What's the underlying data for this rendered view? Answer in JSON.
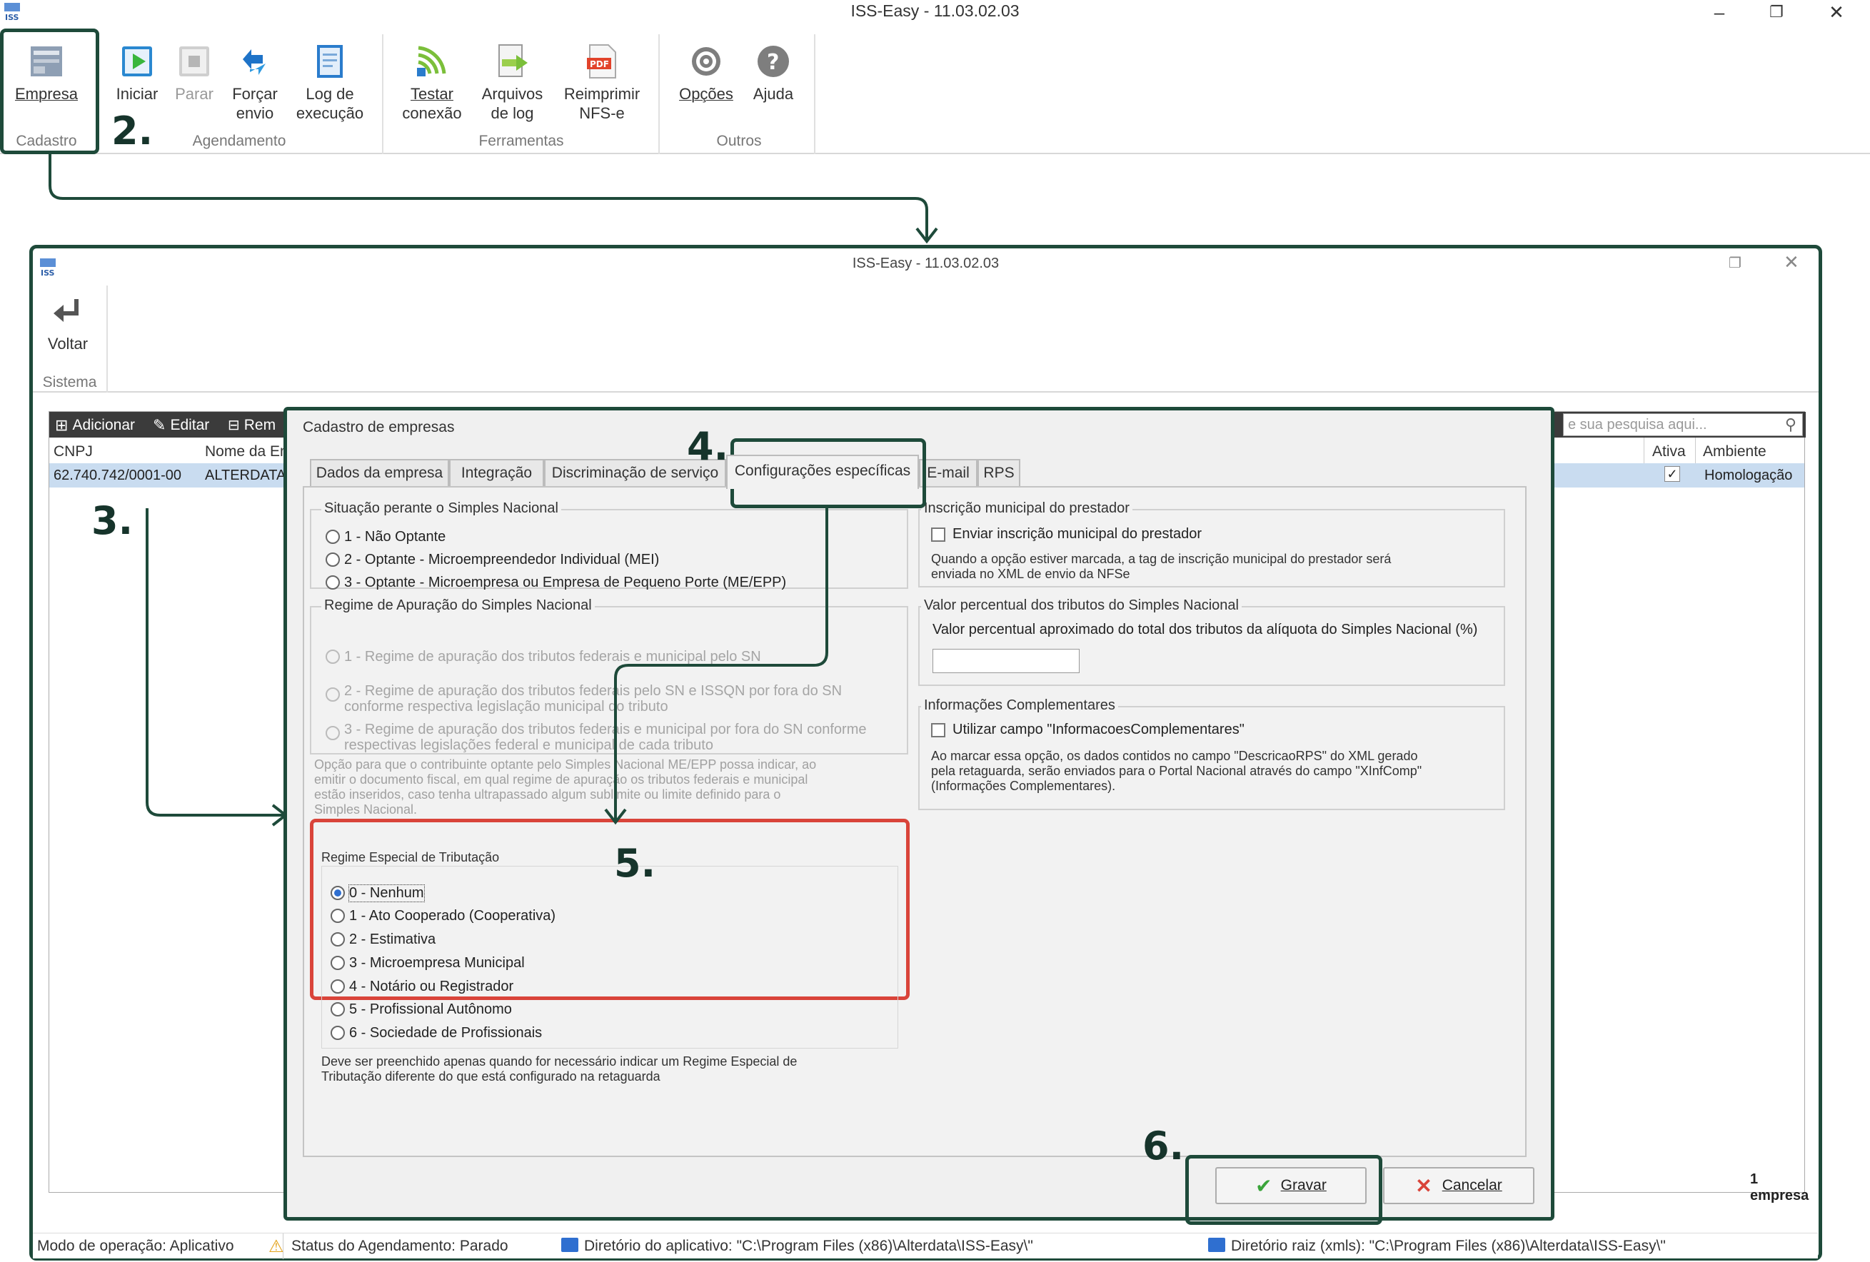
{
  "window": {
    "title": "ISS-Easy - 11.03.02.03"
  },
  "ribbon": {
    "empresa": "Empresa",
    "iniciar": "Iniciar",
    "parar": "Parar",
    "forcar_1": "Forçar",
    "forcar_2": "envio",
    "log_1": "Log de",
    "log_2": "execução",
    "testar_1": "Testar",
    "testar_2": "conexão",
    "arquivos_1": "Arquivos",
    "arquivos_2": "de log",
    "reimprimir_1": "Reimprimir",
    "reimprimir_2": "NFS-e",
    "opcoes": "Opções",
    "ajuda": "Ajuda",
    "groups": {
      "cadastro": "Cadastro",
      "agendamento": "Agendamento",
      "ferramentas": "Ferramentas",
      "outros": "Outros"
    }
  },
  "annotations": {
    "n2": "2.",
    "n3": "3.",
    "n4": "4.",
    "n5": "5.",
    "n6": "6."
  },
  "inner": {
    "title": "ISS-Easy - 11.03.02.03",
    "voltar": "Voltar",
    "sistema": "Sistema",
    "toolbar": {
      "adicionar": "Adicionar",
      "editar": "Editar",
      "remover": "Rem"
    },
    "search_placeholder": "e sua pesquisa aqui...",
    "columns": {
      "cnpj": "CNPJ",
      "nome": "Nome da Em",
      "ativa": "Ativa",
      "ambiente": "Ambiente"
    },
    "row": {
      "cnpj": "62.740.742/0001-00",
      "nome": "ALTERDATA",
      "ambiente": "Homologação"
    },
    "count": "1 empresa"
  },
  "dialog": {
    "title": "Cadastro de empresas",
    "tabs": [
      "Dados da empresa",
      "Integração",
      "Discriminação de serviço",
      "Configurações específicas",
      "E-mail",
      "RPS"
    ],
    "simples": {
      "legend": "Situação perante o Simples Nacional",
      "options": [
        "1 - Não Optante",
        "2 - Optante - Microempreendedor Individual (MEI)",
        "3 - Optante - Microempresa ou Empresa de Pequeno Porte (ME/EPP)"
      ]
    },
    "regime_apuracao": {
      "legend": "Regime de Apuração do Simples Nacional",
      "opt1": "1 - Regime de apuração dos tributos federais e municipal pelo SN",
      "opt2a": "2 - Regime de apuração dos tributos federais pelo SN e ISSQN por fora do SN",
      "opt2b": "conforme respectiva legislação municipal do tributo",
      "opt3a": "3 - Regime de apuração dos tributos federais e municipal por fora do SN conforme",
      "opt3b": "respectivas legislações federal e municipal de cada tributo",
      "note1": "Opção para que o contribuinte optante pelo Simples Nacional ME/EPP possa indicar, ao",
      "note2": "emitir o documento fiscal, em qual regime de apuração os tributos federais e municipal",
      "note3": "estão inseridos, caso tenha ultrapassado algum sublimite ou limite definido para o",
      "note4": "Simples Nacional."
    },
    "regime_especial": {
      "legend": "Regime Especial de Tributação",
      "options": [
        "0 - Nenhum",
        "1 - Ato Cooperado (Cooperativa)",
        "2 - Estimativa",
        "3 - Microempresa Municipal",
        "4 - Notário ou Registrador",
        "5 - Profissional Autônomo",
        "6 - Sociedade de Profissionais"
      ],
      "note1": "Deve ser preenchido apenas quando for necessário indicar um Regime Especial de",
      "note2": "Tributação diferente do que está configurado na retaguarda"
    },
    "inscricao": {
      "legend": "Inscrição municipal do prestador",
      "check": "Enviar inscrição municipal do prestador",
      "note1": "Quando a opção estiver marcada, a tag de inscrição municipal do prestador será",
      "note2": "enviada no XML de envio da NFSe"
    },
    "percentual": {
      "legend": "Valor percentual dos tributos do Simples Nacional",
      "label": "Valor percentual aproximado do total dos tributos da alíquota do Simples Nacional (%)"
    },
    "complementares": {
      "legend": "Informações Complementares",
      "check": "Utilizar campo \"InformacoesComplementares\"",
      "note1": "Ao marcar essa opção, os dados contidos no campo \"DescricaoRPS\" do XML gerado",
      "note2": "pela retaguarda, serão enviados para o Portal Nacional através do campo \"XInfComp\"",
      "note3": "(Informações Complementares)."
    },
    "gravar": "Gravar",
    "cancelar": "Cancelar"
  },
  "status": {
    "modo": "Modo de operação: Aplicativo",
    "agendamento": "Status do Agendamento: Parado",
    "diretorio_app": "Diretório do aplicativo: \"C:\\Program Files (x86)\\Alterdata\\ISS-Easy\\\"",
    "diretorio_raiz": "Diretório raiz (xmls): \"C:\\Program Files (x86)\\Alterdata\\ISS-Easy\\\""
  },
  "colors": {
    "annotation": "#1e4a3a",
    "highlight": "#d9443a",
    "selection": "#c9dcf0"
  }
}
